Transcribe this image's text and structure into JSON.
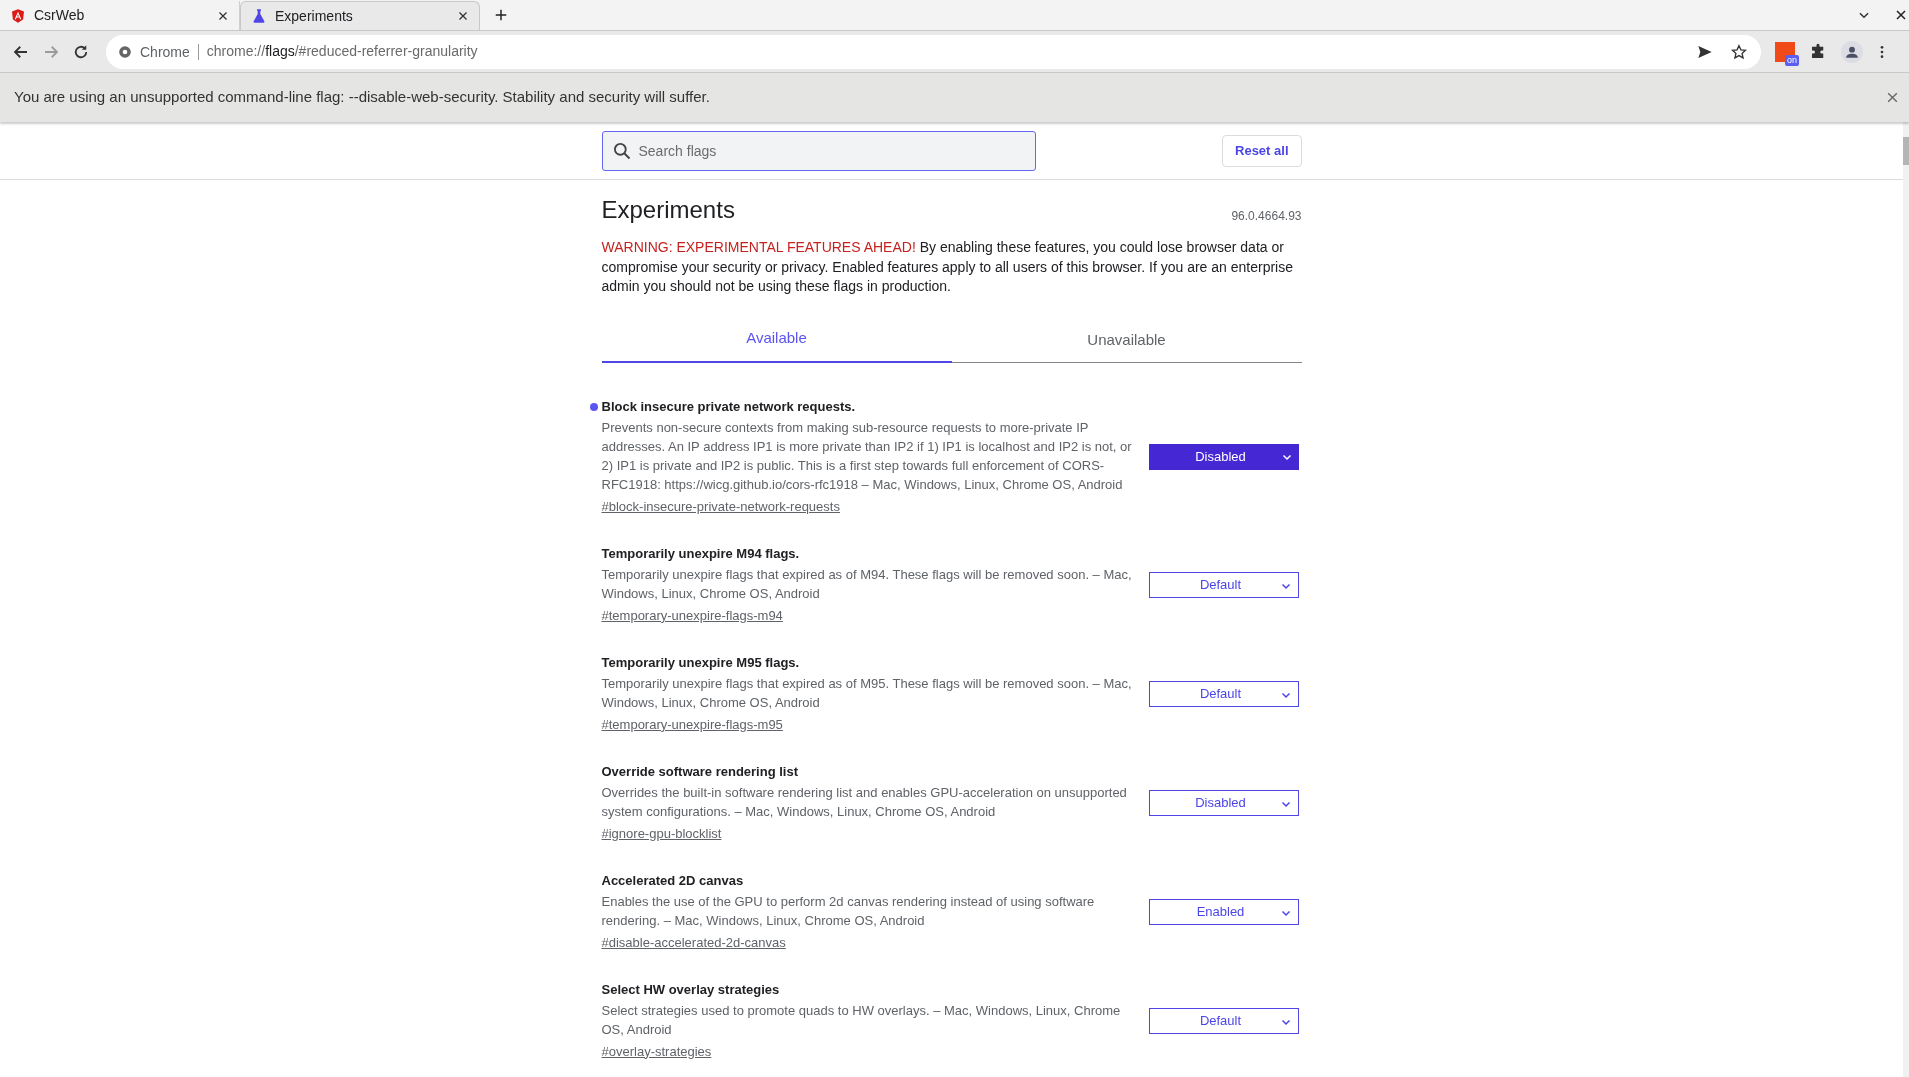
{
  "tabs": [
    {
      "kind": "shield",
      "title": "CsrWeb",
      "selected": false
    },
    {
      "kind": "flask",
      "title": "Experiments",
      "selected": true
    }
  ],
  "nav_buttons": [
    {
      "kind": "back",
      "disabled": false
    },
    {
      "kind": "forward",
      "disabled": true
    },
    {
      "kind": "reload",
      "disabled": false
    }
  ],
  "omnibox": {
    "chip": "Chrome",
    "scheme": "chrome://",
    "host": "flags",
    "path": "/#reduced-referrer-granularity"
  },
  "extension_badge": "on",
  "infobar": {
    "message": "You are using an unsupported command-line flag: --disable-web-security. Stability and security will suffer."
  },
  "search": {
    "placeholder": "Search flags"
  },
  "reset_button": "Reset all",
  "title": "Experiments",
  "version": "96.0.4664.93",
  "warning": {
    "lead": "WARNING: EXPERIMENTAL FEATURES AHEAD!",
    "text": " By enabling these features, you could lose browser data or compromise your security or privacy. Enabled features apply to all users of this browser. If you are an enterprise admin you should not be using these flags in production."
  },
  "page_tabs": [
    {
      "label": "Available",
      "selected": true
    },
    {
      "label": "Unavailable",
      "selected": false
    }
  ],
  "flags": [
    {
      "title": "Block insecure private network requests.",
      "description": "Prevents non-secure contexts from making sub-resource requests to more-private IP addresses. An IP address IP1 is more private than IP2 if 1) IP1 is localhost and IP2 is not, or 2) IP1 is private and IP2 is public. This is a first step towards full enforcement of CORS-RFC1918: https://wicg.github.io/cors-rfc1918 – Mac, Windows, Linux, Chrome OS, Android",
      "link": "#block-insecure-private-network-requests",
      "value": "Disabled",
      "modified": true
    },
    {
      "title": "Temporarily unexpire M94 flags.",
      "description": "Temporarily unexpire flags that expired as of M94. These flags will be removed soon. – Mac, Windows, Linux, Chrome OS, Android",
      "link": "#temporary-unexpire-flags-m94",
      "value": "Default",
      "modified": false
    },
    {
      "title": "Temporarily unexpire M95 flags.",
      "description": "Temporarily unexpire flags that expired as of M95. These flags will be removed soon. – Mac, Windows, Linux, Chrome OS, Android",
      "link": "#temporary-unexpire-flags-m95",
      "value": "Default",
      "modified": false
    },
    {
      "title": "Override software rendering list",
      "description": "Overrides the built-in software rendering list and enables GPU-acceleration on unsupported system configurations. – Mac, Windows, Linux, Chrome OS, Android",
      "link": "#ignore-gpu-blocklist",
      "value": "Disabled",
      "modified": false
    },
    {
      "title": "Accelerated 2D canvas",
      "description": "Enables the use of the GPU to perform 2d canvas rendering instead of using software rendering. – Mac, Windows, Linux, Chrome OS, Android",
      "link": "#disable-accelerated-2d-canvas",
      "value": "Enabled",
      "modified": false
    },
    {
      "title": "Select HW overlay strategies",
      "description": "Select strategies used to promote quads to HW overlays. – Mac, Windows, Linux, Chrome OS, Android",
      "link": "#overlay-strategies",
      "value": "Default",
      "modified": false
    }
  ]
}
